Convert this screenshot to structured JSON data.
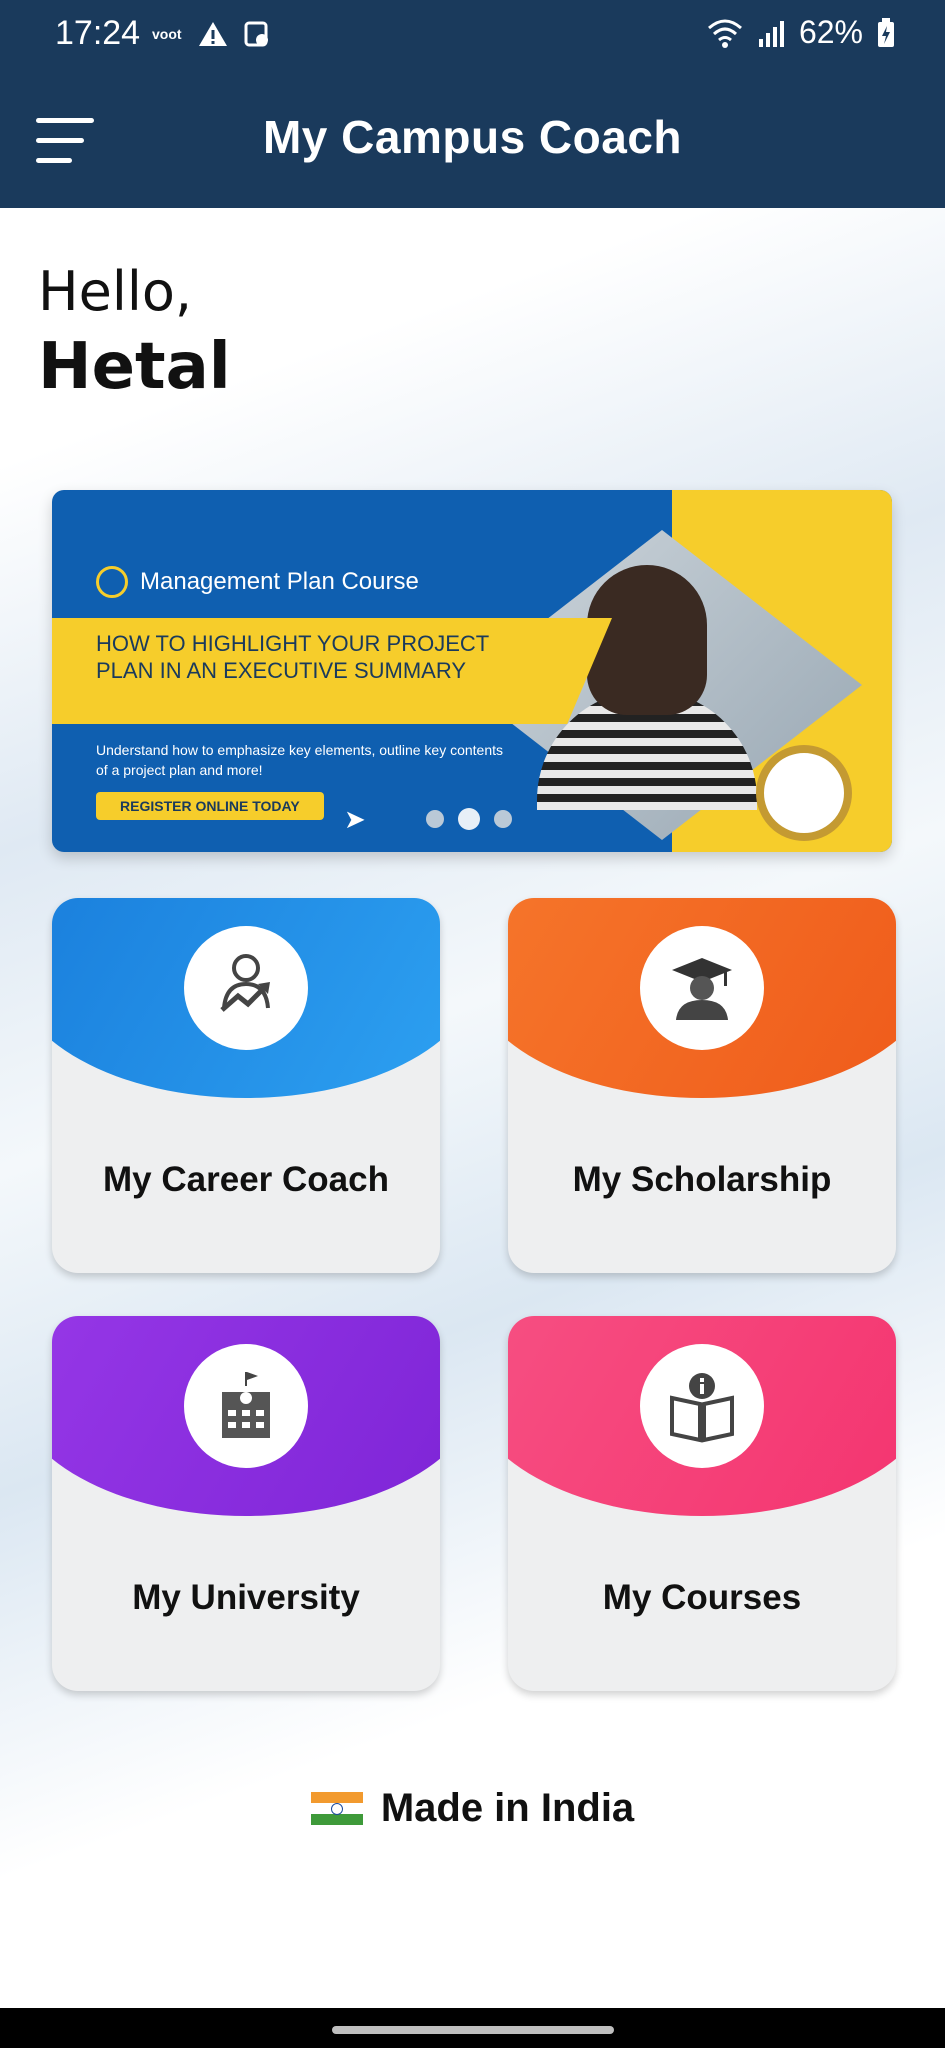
{
  "status_bar": {
    "time": "17:24",
    "voot_label": "voot",
    "battery_text": "62%"
  },
  "header": {
    "title": "My Campus Coach"
  },
  "greeting": {
    "hello": "Hello,",
    "name": "Hetal"
  },
  "banner": {
    "course_title": "Management Plan Course",
    "headline": "HOW TO HIGHLIGHT YOUR PROJECT PLAN IN AN EXECUTIVE SUMMARY",
    "description": "Understand how to emphasize key elements, outline key contents of a project plan and more!",
    "cta": "REGISTER ONLINE TODAY",
    "active_slide": 2,
    "slide_count": 3
  },
  "tiles": [
    {
      "label": "My Career Coach",
      "icon": "career-growth-icon"
    },
    {
      "label": "My Scholarship",
      "icon": "graduate-icon"
    },
    {
      "label": "My University",
      "icon": "university-building-icon"
    },
    {
      "label": "My Courses",
      "icon": "book-info-icon"
    }
  ],
  "footer": {
    "made_in": "Made in India"
  },
  "colors": {
    "header": "#1a3a5c",
    "career": "#1e88e5",
    "scholarship": "#f26a21",
    "university": "#8a2be2",
    "courses": "#f5437a"
  }
}
